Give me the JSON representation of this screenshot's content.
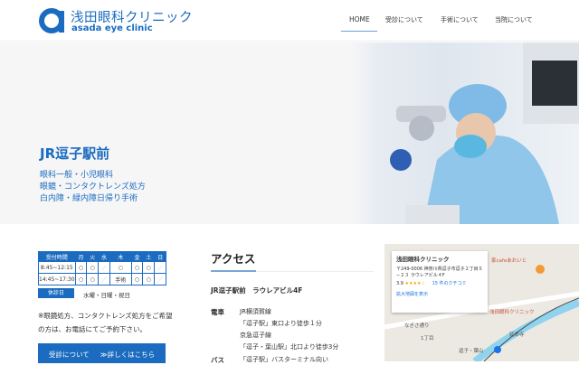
{
  "header": {
    "logo_jp": "浅田眼科クリニック",
    "logo_en": "asada eye clinic",
    "nav": [
      {
        "label": "HOME",
        "active": true
      },
      {
        "label": "受診について"
      },
      {
        "label": "手術について"
      },
      {
        "label": "当院について"
      }
    ]
  },
  "hero": {
    "title": "JR逗子駅前",
    "lines": [
      "眼科一般・小児眼科",
      "眼鏡・コンタクトレンズ処方",
      "白内障・緑内障日帰り手術"
    ]
  },
  "hours": {
    "headers": [
      "受付時間",
      "月",
      "火",
      "水",
      "木",
      "金",
      "土",
      "日"
    ],
    "rows": [
      [
        "8:45~12:15",
        "○",
        "○",
        "／",
        "○",
        "○",
        "○",
        "／"
      ],
      [
        "14:45~17:30",
        "○",
        "○",
        "／",
        "手術",
        "○",
        "○",
        "／"
      ]
    ],
    "holiday_label": "休診日",
    "holiday_text": "水曜・日曜・祝日"
  },
  "note": "※眼鏡処方、コンタクトレンズ処方をご希望の方は、お電話にてご予約下さい。",
  "cta": {
    "label": "受診について",
    "more": "≫詳しくはこちら"
  },
  "access": {
    "heading": "アクセス",
    "address": "JR逗子駅前　ラウレアビル4F",
    "train_label": "電車",
    "train_lines": [
      "JR横須賀線",
      "「逗子駅」東口より徒歩１分",
      "京急逗子線",
      "「逗子・葉山駅」北口より徒歩3分"
    ],
    "bus_label": "バス",
    "bus_lines": [
      "「逗子駅」バスターミナル向い"
    ]
  },
  "map": {
    "name": "浅田眼科クリニック",
    "address": "〒249-0006 神奈川県逗子市逗子２丁目５−２３ ラウレアビル４F",
    "rating": "3.9",
    "stars": "★★★★☆",
    "reviews": "15 件のクチコミ",
    "enlarge": "拡大地図を表示",
    "labels": [
      "家cafeあおいと",
      "浅田眼科クリニック",
      "なぎさ通り",
      "1丁目",
      "逗子・葉山",
      "延命寺"
    ]
  }
}
